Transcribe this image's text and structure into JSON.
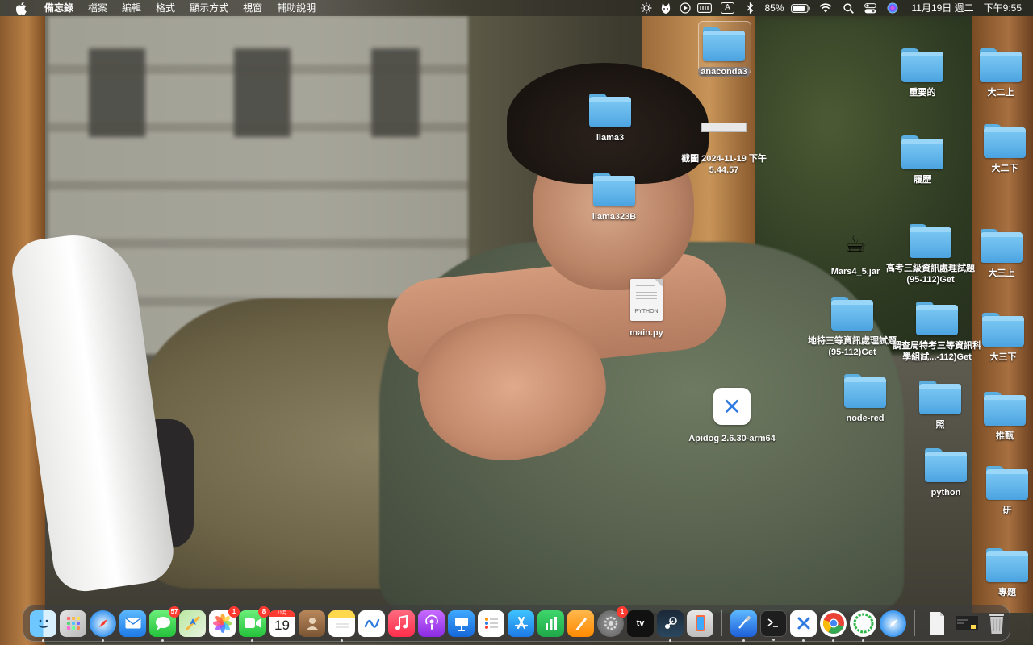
{
  "menubar": {
    "app_name": "備忘錄",
    "menus": [
      "檔案",
      "編輯",
      "格式",
      "顯示方式",
      "視窗",
      "輔助說明"
    ],
    "input_source": "A",
    "battery_percent": "85%",
    "battery_level": 0.85,
    "date": "11月19日 週二",
    "time": "下午9:55"
  },
  "desktop": {
    "anaconda3": "anaconda3",
    "llama3": "llama3",
    "llama323B": "llama323B",
    "screenshot": "截圖 2024-11-19 下午5.44.57",
    "main_py": "main.py",
    "main_py_type": "PYTHON",
    "mars_jar": "Mars4_5.jar",
    "apidog": "Apidog 2.6.30-arm64",
    "important": "重要的",
    "resume": "履歷",
    "exam_high": "高考三級資訊處理試題(95-112)Get",
    "exam_local": "地特三等資訊處理試題(95-112)Get",
    "exam_invest": "調查局特考三等資訊科學組試...-112)Get",
    "node_red": "node-red",
    "photo": "照",
    "python": "python",
    "y2_up": "大二上",
    "y2_down": "大二下",
    "y3_up": "大三上",
    "y3_down": "大三下",
    "recommend": "推甄",
    "research": "研",
    "topic": "專題"
  },
  "dock": {
    "messages_badge": "57",
    "photos_badge": "1",
    "facetime_badge": "8",
    "calendar_month": "11月",
    "calendar_day": "19",
    "settings_badge": "1",
    "appletv_label": "tv"
  },
  "colors": {
    "folder": "#62b5ea",
    "badge": "#ff3b30"
  }
}
